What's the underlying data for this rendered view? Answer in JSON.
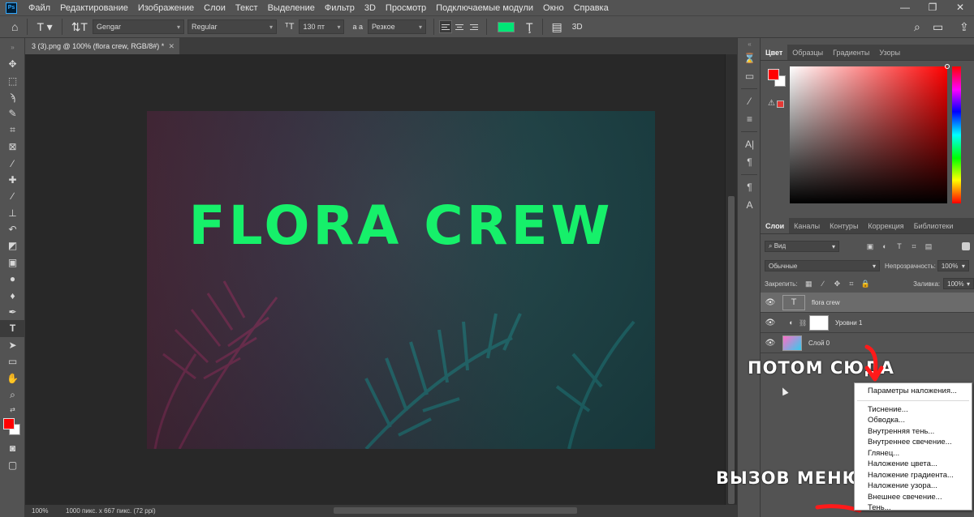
{
  "menubar": {
    "items": [
      "Файл",
      "Редактирование",
      "Изображение",
      "Слои",
      "Текст",
      "Выделение",
      "Фильтр",
      "3D",
      "Просмотр",
      "Подключаемые модули",
      "Окно",
      "Справка"
    ],
    "window_controls": [
      "—",
      "❐",
      "✕"
    ]
  },
  "options": {
    "font_family": "Gengar",
    "font_style": "Regular",
    "font_size": "130 пт",
    "aa_icon": "a a",
    "antialias": "Резкое",
    "text_color": "#00e676",
    "label_3d": "3D"
  },
  "document": {
    "tab_title": "3 (3).png @ 100% (flora crew, RGB/8#) *",
    "text": "FLORA CREW",
    "zoom": "100%",
    "info": "1000 пикс. x 667 пикс. (72 ppi)"
  },
  "color_panel": {
    "tabs": [
      "Цвет",
      "Образцы",
      "Градиенты",
      "Узоры"
    ],
    "foreground": "#ff0000",
    "background": "#ffffff"
  },
  "layers_panel": {
    "tabs": [
      "Слои",
      "Каналы",
      "Контуры",
      "Коррекция",
      "Библиотеки"
    ],
    "filter_label": "Вид",
    "blend_mode": "Обычные",
    "opacity_label": "Непрозрачность:",
    "opacity_value": "100%",
    "lock_label": "Закрепить:",
    "fill_label": "Заливка:",
    "fill_value": "100%",
    "layers": [
      {
        "name": "flora crew",
        "kind": "text"
      },
      {
        "name": "Уровни 1",
        "kind": "adjustment"
      },
      {
        "name": "Слой 0",
        "kind": "image"
      }
    ]
  },
  "annotations": {
    "top": "ПОТОМ СЮДА",
    "bottom": "ВЫЗОВ МЕНЮ"
  },
  "context_menu": {
    "first": "Параметры наложения...",
    "items": [
      "Тиснение...",
      "Обводка...",
      "Внутренняя тень...",
      "Внутреннее свечение...",
      "Глянец...",
      "Наложение цвета...",
      "Наложение градиента...",
      "Наложение узора...",
      "Внешнее свечение...",
      "Тень..."
    ]
  }
}
